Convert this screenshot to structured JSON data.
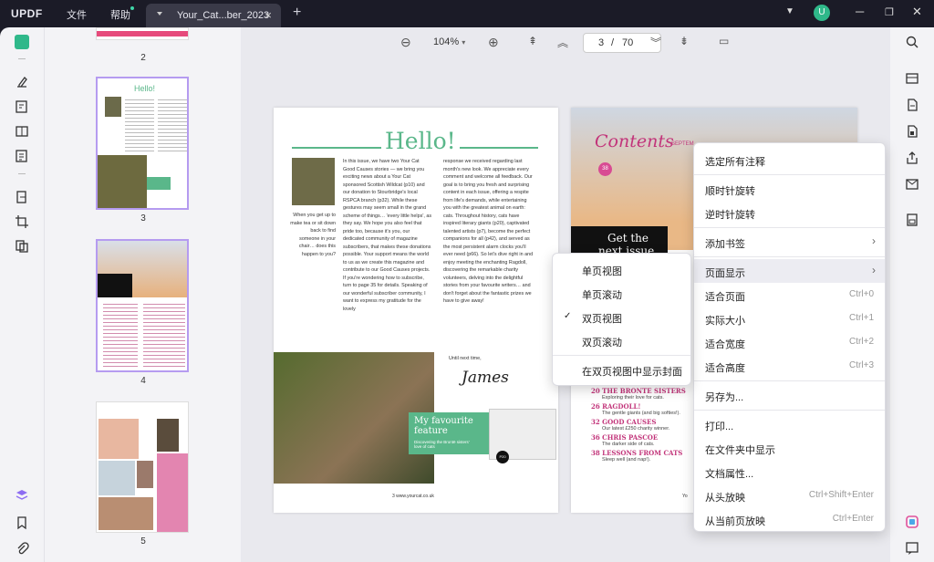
{
  "titlebar": {
    "logo": "UPDF",
    "menu_file": "文件",
    "menu_help": "帮助",
    "tab_name": "Your_Cat...ber_2023",
    "tab_close": "×",
    "new_tab": "+",
    "avatar_letter": "U"
  },
  "toolbar": {
    "zoom": "104%",
    "page_current": "3",
    "page_sep": "/",
    "page_total": "70"
  },
  "thumbnails": [
    {
      "label": "2"
    },
    {
      "label": "3"
    },
    {
      "label": "4"
    },
    {
      "label": "5"
    }
  ],
  "page3": {
    "hello": "Hello!",
    "intro_side": "When you get up to make tea or sit down back to find someone in your chair… does this happen to you?",
    "col1": "In this issue, we have two Your Cat Good Causes stories — we bring you exciting news about a Your Cat sponsored Scottish Wildcat (p10) and our donation to Stourbridge's local RSPCA branch (p32). While these gestures may seem small in the grand scheme of things… 'every little helps', as they say. We hope you also feel that pride too, because it's you, our dedicated community of magazine subscribers, that makes these donations possible. Your support means the world to us as we create this magazine and contribute to our Good Causes projects. If you're wondering how to subscribe, turn to page 35 for details. Speaking of our wonderful subscriber community, I want to express my gratitude for the lovely",
    "col2": "response we received regarding last month's new look. We appreciate every comment and welcome all feedback. Our goal is to bring you fresh and surprising content in each issue, offering a respite from life's demands, while entertaining you with the greatest animal on earth: cats. Throughout history, cats have inspired literary giants (p20), captivated talented artists (p7), become the perfect companions for all (p42), and served as the most persistent alarm clocks you'll ever need (p66). So let's dive right in and enjoy meeting the enchanting Ragdoll, discovering the remarkable charity volunteers, delving into the delightful stories from your favourite writers… and don't forget about the fantastic prizes we have to give away!",
    "until_next": "Until next time,",
    "signature": "James",
    "feature_title": "My favourite feature",
    "feature_sub": "Discovering the Brontë sisters' love of cats",
    "footer": "3   www.yourcat.co.uk",
    "badge": "P20"
  },
  "page4": {
    "contents": "Contents",
    "month": "SEPTEM",
    "num38": "38",
    "get_the": "Get the",
    "next_issue": "next issue",
    "items": [
      {
        "title": "20 THE BRONTE SISTERS",
        "sub": "Exploring their love for cats."
      },
      {
        "title": "26 RAGDOLL!",
        "sub": "The gentle giants (and big softies!)."
      },
      {
        "title": "32 GOOD CAUSES",
        "sub": "Our latest £250 charity winner."
      },
      {
        "title": "36 CHRIS PASCOE",
        "sub": "The darker side of cats."
      },
      {
        "title": "38 LESSONS FROM CATS",
        "sub": "Sleep well (and nap!)."
      }
    ],
    "footer_y": "Yo"
  },
  "context_menu": {
    "items": [
      {
        "label": "选定所有注释",
        "shortcut": ""
      },
      {
        "label": "顺时针旋转",
        "shortcut": ""
      },
      {
        "label": "逆时针旋转",
        "shortcut": ""
      },
      {
        "label": "添加书签",
        "shortcut": ""
      },
      {
        "label": "页面显示",
        "shortcut": ""
      },
      {
        "label": "适合页面",
        "shortcut": "Ctrl+0"
      },
      {
        "label": "实际大小",
        "shortcut": "Ctrl+1"
      },
      {
        "label": "适合宽度",
        "shortcut": "Ctrl+2"
      },
      {
        "label": "适合高度",
        "shortcut": "Ctrl+3"
      },
      {
        "label": "另存为...",
        "shortcut": ""
      },
      {
        "label": "打印...",
        "shortcut": ""
      },
      {
        "label": "在文件夹中显示",
        "shortcut": ""
      },
      {
        "label": "文档属性...",
        "shortcut": ""
      },
      {
        "label": "从头放映",
        "shortcut": "Ctrl+Shift+Enter"
      },
      {
        "label": "从当前页放映",
        "shortcut": "Ctrl+Enter"
      }
    ]
  },
  "submenu": {
    "items": [
      {
        "label": "单页视图",
        "checked": false
      },
      {
        "label": "单页滚动",
        "checked": false
      },
      {
        "label": "双页视图",
        "checked": true
      },
      {
        "label": "双页滚动",
        "checked": false
      },
      {
        "label": "在双页视图中显示封面",
        "checked": false
      }
    ],
    "check_mark": "✓"
  },
  "colors": {
    "accent": "#7b5cf0",
    "green": "#5ab78a",
    "pink": "#c2347a"
  }
}
